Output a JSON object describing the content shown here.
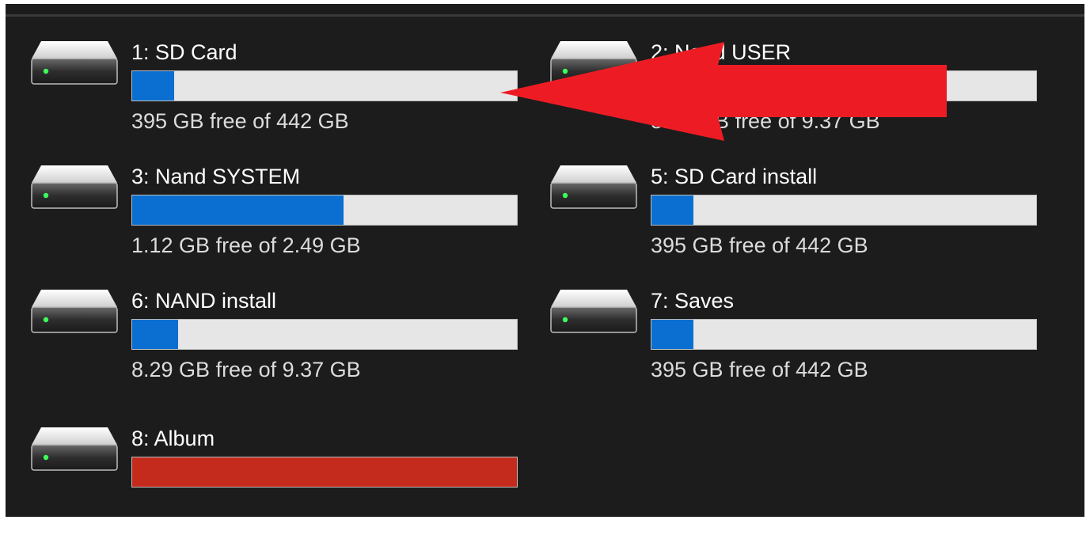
{
  "drives": [
    {
      "id": "1",
      "name": "1: SD Card",
      "free_text": "395 GB free of 442 GB",
      "used_fraction": 0.11,
      "full": false
    },
    {
      "id": "2",
      "name": "2: Nand USER",
      "free_text": "8.29 GB free of 9.37 GB",
      "used_fraction": 0.11,
      "full": false
    },
    {
      "id": "3",
      "name": "3: Nand SYSTEM",
      "free_text": "1.12 GB free of 2.49 GB",
      "used_fraction": 0.55,
      "full": false
    },
    {
      "id": "5",
      "name": "5: SD Card install",
      "free_text": "395 GB free of 442 GB",
      "used_fraction": 0.11,
      "full": false
    },
    {
      "id": "6",
      "name": "6: NAND install",
      "free_text": "8.29 GB free of 9.37 GB",
      "used_fraction": 0.12,
      "full": false
    },
    {
      "id": "7",
      "name": "7: Saves",
      "free_text": "395 GB free of 442 GB",
      "used_fraction": 0.11,
      "full": false
    },
    {
      "id": "8",
      "name": "8: Album",
      "free_text": "",
      "used_fraction": 1.0,
      "full": true
    }
  ],
  "icons": {
    "drive": "hard-drive-icon",
    "annotation": "red-arrow-annotation"
  },
  "colors": {
    "bar_fill": "#0a6fd1",
    "bar_full": "#c42b1c",
    "bar_empty": "#e6e6e6",
    "background": "#1c1c1c",
    "arrow": "#ed1c24"
  }
}
